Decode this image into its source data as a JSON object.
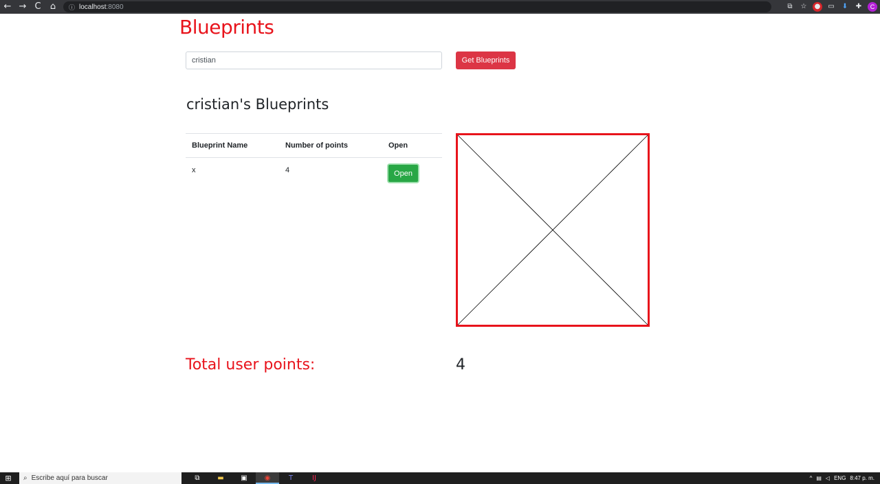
{
  "browser": {
    "url_host": "localhost",
    "url_port": ":8080",
    "nav": {
      "back": "←",
      "forward": "→",
      "reload": "C",
      "home": "⌂"
    },
    "info_icon": "ⓘ",
    "avatar_letter": "C"
  },
  "app": {
    "title": "Blueprints",
    "author_input_value": "cristian",
    "get_button_label": "Get Blueprints",
    "subtitle": "cristian's Blueprints",
    "table": {
      "headers": [
        "Blueprint Name",
        "Number of points",
        "Open"
      ],
      "rows": [
        {
          "name": "x",
          "points": "4",
          "action": "Open"
        }
      ]
    },
    "total_label": "Total user points:",
    "total_value": "4",
    "canvas": {
      "border_color": "#e8131b",
      "lines": [
        {
          "from": [
            0,
            0
          ],
          "to": [
            1,
            1
          ]
        },
        {
          "from": [
            1,
            0
          ],
          "to": [
            0,
            1
          ]
        }
      ]
    }
  },
  "colors": {
    "accent_red": "#e8131b",
    "danger_button": "#dc3545",
    "success_button": "#28a745"
  },
  "taskbar": {
    "search_placeholder": "Escribe aquí para buscar",
    "lang": "ENG",
    "time": "8:47 p. m."
  }
}
